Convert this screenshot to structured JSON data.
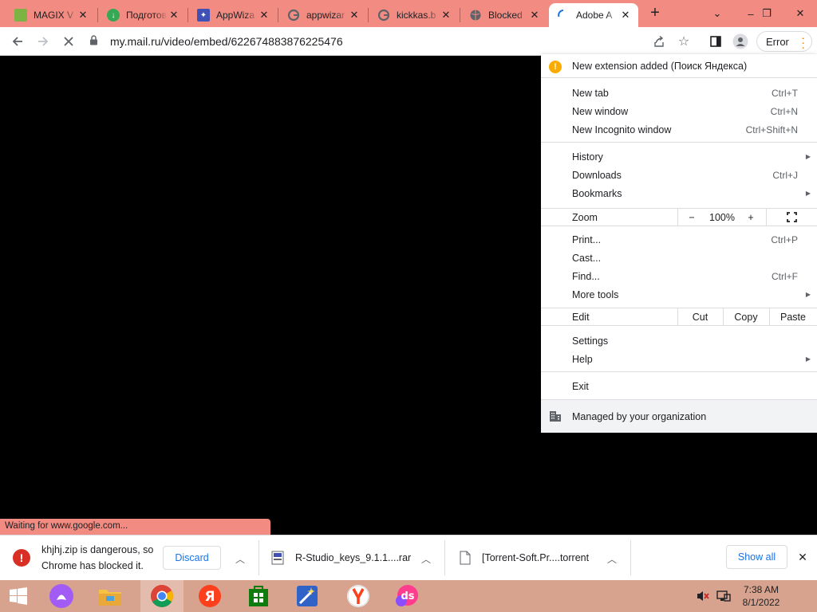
{
  "tabs": [
    {
      "title": "MAGIX V",
      "icon": "magix-icon",
      "color": "#7cb342"
    },
    {
      "title": "Подготов",
      "icon": "download-icon",
      "color": "#34a853"
    },
    {
      "title": "AppWiza",
      "icon": "appwizard-icon",
      "color": "#3f51b5"
    },
    {
      "title": "appwizar",
      "icon": "google-icon",
      "color": "#4285f4"
    },
    {
      "title": "kickkas.b",
      "icon": "google-icon",
      "color": "#4285f4"
    },
    {
      "title": "Blocked",
      "icon": "globe-icon",
      "color": "#5f6368"
    },
    {
      "title": "Adobe A",
      "icon": "loading-icon",
      "color": "#1a73e8",
      "active": true
    }
  ],
  "window_controls": {
    "tab_search": "⌄",
    "minimize": "–",
    "restore": "❐",
    "close": "✕"
  },
  "toolbar": {
    "url": "my.mail.ru/video/embed/622674883876225476",
    "error_label": "Error"
  },
  "menu": {
    "notice": "New extension added (Поиск Яндекса)",
    "new_tab": {
      "label": "New tab",
      "shortcut": "Ctrl+T"
    },
    "new_window": {
      "label": "New window",
      "shortcut": "Ctrl+N"
    },
    "new_incognito": {
      "label": "New Incognito window",
      "shortcut": "Ctrl+Shift+N"
    },
    "history": {
      "label": "History"
    },
    "downloads": {
      "label": "Downloads",
      "shortcut": "Ctrl+J"
    },
    "bookmarks": {
      "label": "Bookmarks"
    },
    "zoom": {
      "label": "Zoom",
      "minus": "−",
      "value": "100%",
      "plus": "+"
    },
    "print": {
      "label": "Print...",
      "shortcut": "Ctrl+P"
    },
    "cast": {
      "label": "Cast..."
    },
    "find": {
      "label": "Find...",
      "shortcut": "Ctrl+F"
    },
    "more_tools": {
      "label": "More tools"
    },
    "edit": {
      "label": "Edit",
      "cut": "Cut",
      "copy": "Copy",
      "paste": "Paste"
    },
    "settings": {
      "label": "Settings"
    },
    "help": {
      "label": "Help"
    },
    "exit": {
      "label": "Exit"
    },
    "managed": "Managed by your organization"
  },
  "status_text": "Waiting for www.google.com...",
  "downloads": {
    "danger_line1": "khjhj.zip is dangerous, so",
    "danger_line2": "Chrome has blocked it.",
    "discard_label": "Discard",
    "item2": "R-Studio_keys_9.1.1....rar",
    "item3": "[Torrent-Soft.Pr....torrent",
    "show_all": "Show all"
  },
  "taskbar": {
    "time": "7:38 AM",
    "date": "8/1/2022",
    "apps": [
      "windows-start-icon",
      "alice-icon",
      "file-explorer-icon",
      "chrome-icon",
      "yandex-ya-icon",
      "store-icon",
      "appwizard-icon",
      "yandex-browser-icon",
      "ds-icon"
    ]
  },
  "colors": {
    "tab_strip": "#f28b82",
    "taskbar": "#d8a38e",
    "accent": "#1a73e8",
    "danger": "#d93025"
  }
}
